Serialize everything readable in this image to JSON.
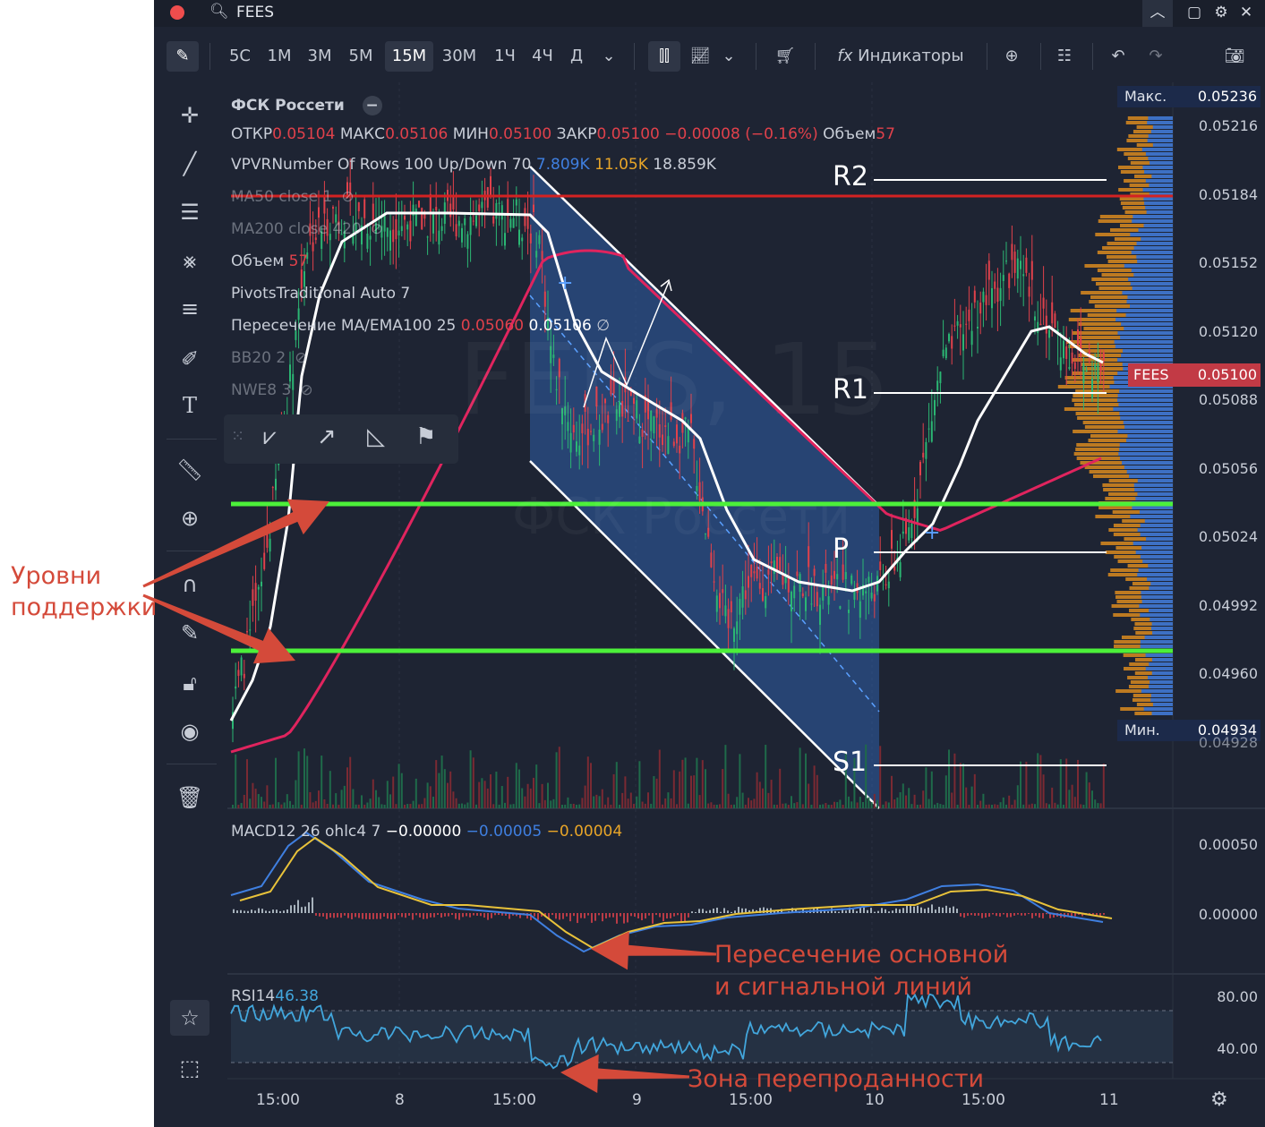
{
  "window": {
    "ticker": "FEES"
  },
  "toolbar": {
    "timeframes": [
      "5С",
      "1М",
      "3М",
      "5М",
      "15М",
      "30М",
      "1Ч",
      "4Ч",
      "Д"
    ],
    "active_timeframe": "15М",
    "indicators_label": "Индикаторы"
  },
  "legend": {
    "symbol": "ФСК Россети",
    "ohlc": {
      "open_label": "ОТКР",
      "open": "0.05104",
      "high_label": "МАКС",
      "high": "0.05106",
      "low_label": "МИН",
      "low": "0.05100",
      "close_label": "ЗАКР",
      "close": "0.05100",
      "change": "−0.00008 (−0.16%)",
      "vol_label": "Объем",
      "vol": "57"
    },
    "vpvr": {
      "label": "VPVRNumber Of Rows 100 Up/Down 70",
      "up": "7.809K",
      "down": "11.05K",
      "total": "18.859K"
    },
    "ma50": "MA50 close 1",
    "ma200": "MA200 close 420",
    "volume": {
      "label": "Объем",
      "value": "57"
    },
    "pivots": "PivotsTraditional Auto 7",
    "cross": {
      "label": "Пересечение MA/EMA100 25",
      "v1": "0.05060",
      "v2": "0.05106",
      "v3": "∅"
    },
    "bb": "BB20 2",
    "nwe": "NWE8 3"
  },
  "price_scale": {
    "max_label": "Макс.",
    "max": "0.05236",
    "labels": [
      "0.05216",
      "0.05184",
      "0.05152",
      "0.05120",
      "0.05088",
      "0.05056",
      "0.05024",
      "0.04992",
      "0.04960",
      "0.04928"
    ],
    "current_label": "FEES",
    "current": "0.05100",
    "min_label": "Мин.",
    "min": "0.04934"
  },
  "levels": {
    "r2": "R2",
    "r1": "R1",
    "p": "P",
    "s1": "S1"
  },
  "watermark": {
    "ticker": "FEES, 15",
    "name": "ФСК Россети"
  },
  "macd": {
    "label": "MACD12 26 ohlc4 7",
    "v1": "−0.00000",
    "v2": "−0.00005",
    "v3": "−0.00004",
    "scale": [
      "0.00050",
      "0.00000"
    ]
  },
  "rsi": {
    "label": "RSI14",
    "value": "46.38",
    "scale": [
      "80.00",
      "40.00"
    ]
  },
  "time_axis": [
    "15:00",
    "8",
    "15:00",
    "9",
    "15:00",
    "10",
    "15:00",
    "11"
  ],
  "annotations": {
    "support_line1": "Уровни",
    "support_line2": "поддержки",
    "cross_line1": "Пересечение основной",
    "cross_line2": "и сигнальной линий",
    "oversold": "Зона перепроданности"
  },
  "colors": {
    "bg": "#1e2433",
    "ma_red": "#e0245e",
    "line_white": "#ffffff",
    "support": "#4cf03a",
    "resist": "#d42222",
    "channel": "#2f5fa8",
    "annotation": "#d44a3a"
  }
}
